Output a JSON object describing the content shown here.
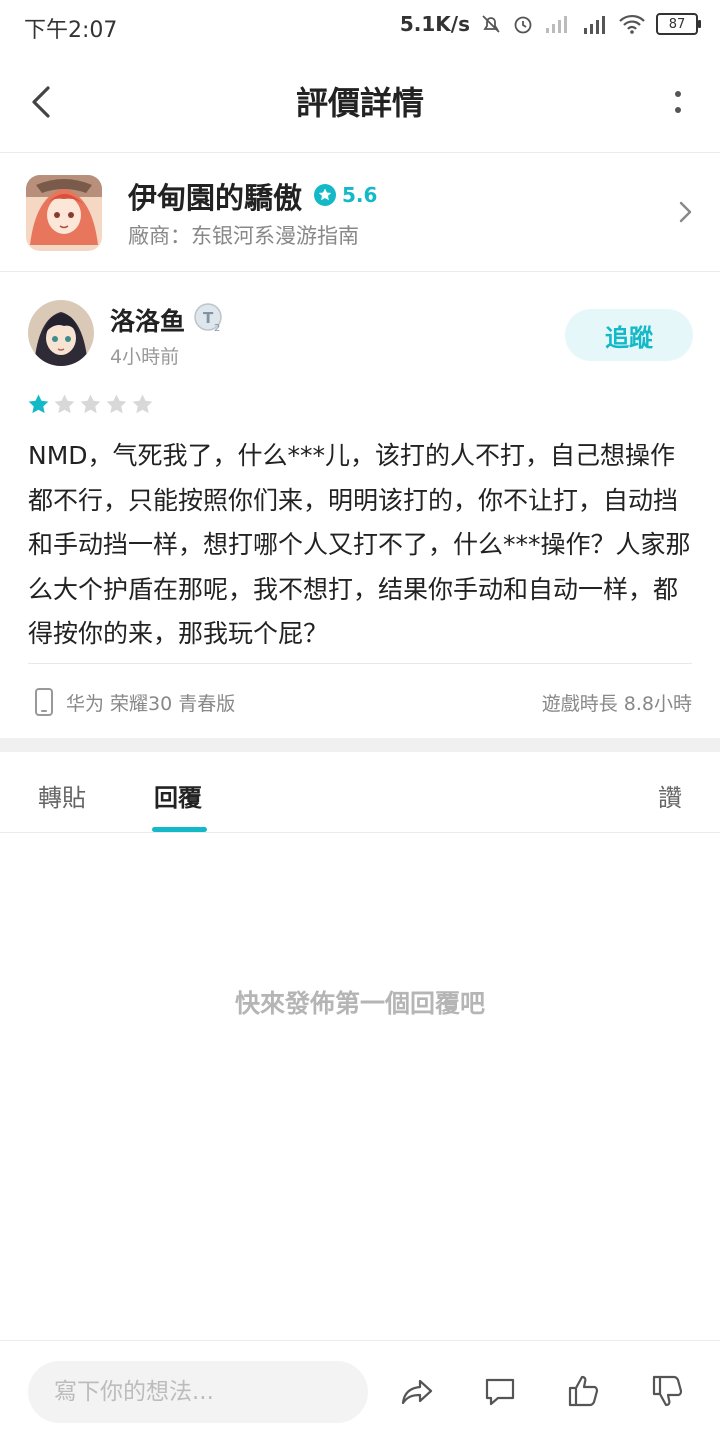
{
  "status_bar": {
    "time": "下午2:07",
    "net_speed": "5.1K/s",
    "battery": "87"
  },
  "header": {
    "title": "評價詳情"
  },
  "app": {
    "name": "伊甸園的驕傲",
    "rating": "5.6",
    "vendor": "廠商：东银河系漫游指南"
  },
  "review": {
    "username": "洛洛鱼",
    "time_ago": "4小時前",
    "follow_label": "追蹤",
    "stars": 1,
    "stars_max": 5,
    "text": "NMD，气死我了，什么***儿，该打的人不打，自己想操作都不行，只能按照你们来，明明该打的，你不让打，自动挡和手动挡一样，想打哪个人又打不了，什么***操作？人家那么大个护盾在那呢，我不想打，结果你手动和自动一样，都得按你的来，那我玩个屁？",
    "device": "华为 荣耀30 青春版",
    "playtime": "遊戲時長 8.8小時"
  },
  "tabs": {
    "repost": "轉貼",
    "reply": "回覆",
    "like": "讚"
  },
  "empty_hint": "快來發佈第一個回覆吧",
  "bottom_bar": {
    "placeholder": "寫下你的想法..."
  },
  "colors": {
    "accent": "#14b9c8",
    "star_empty": "#d8d8d8"
  }
}
